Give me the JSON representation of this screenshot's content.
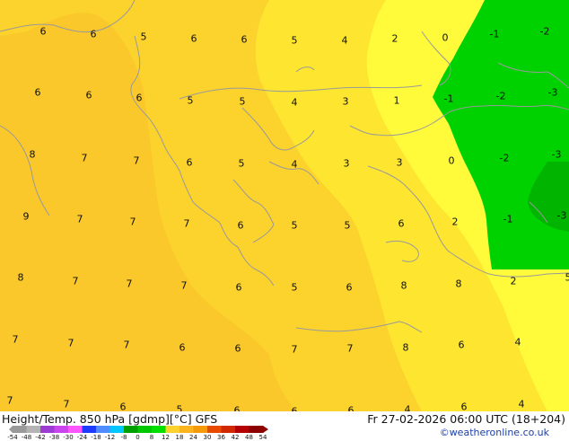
{
  "map": {
    "colors": {
      "band_5_7": "#fcd22c",
      "band_7_9": "#fbc82c",
      "band_3_5": "#fde530",
      "band_0_3": "#fffb3a",
      "band_neg": "#00d200",
      "band_neg_deep": "#00b400",
      "coastline": "#9a9a9a"
    },
    "values": [
      {
        "text": "6"
      },
      {
        "text": "6"
      },
      {
        "text": "5"
      },
      {
        "text": "6"
      },
      {
        "text": "6"
      },
      {
        "text": "5"
      },
      {
        "text": "4"
      },
      {
        "text": "2"
      },
      {
        "text": "0"
      },
      {
        "text": "-1"
      },
      {
        "text": "-2"
      },
      {
        "text": "6"
      },
      {
        "text": "6"
      },
      {
        "text": "6"
      },
      {
        "text": "5"
      },
      {
        "text": "5"
      },
      {
        "text": "4"
      },
      {
        "text": "3"
      },
      {
        "text": "1"
      },
      {
        "text": "-1"
      },
      {
        "text": "-2"
      },
      {
        "text": "-3"
      },
      {
        "text": "8"
      },
      {
        "text": "7"
      },
      {
        "text": "7"
      },
      {
        "text": "6"
      },
      {
        "text": "5"
      },
      {
        "text": "4"
      },
      {
        "text": "3"
      },
      {
        "text": "3"
      },
      {
        "text": "0"
      },
      {
        "text": "-2"
      },
      {
        "text": "-3"
      },
      {
        "text": "9"
      },
      {
        "text": "7"
      },
      {
        "text": "7"
      },
      {
        "text": "7"
      },
      {
        "text": "6"
      },
      {
        "text": "5"
      },
      {
        "text": "5"
      },
      {
        "text": "6"
      },
      {
        "text": "2"
      },
      {
        "text": "-1"
      },
      {
        "text": "-3"
      },
      {
        "text": "8"
      },
      {
        "text": "7"
      },
      {
        "text": "7"
      },
      {
        "text": "7"
      },
      {
        "text": "6"
      },
      {
        "text": "5"
      },
      {
        "text": "6"
      },
      {
        "text": "8"
      },
      {
        "text": "8"
      },
      {
        "text": "2"
      },
      {
        "text": "5"
      },
      {
        "text": "7"
      },
      {
        "text": "7"
      },
      {
        "text": "7"
      },
      {
        "text": "6"
      },
      {
        "text": "6"
      },
      {
        "text": "7"
      },
      {
        "text": "7"
      },
      {
        "text": "8"
      },
      {
        "text": "6"
      },
      {
        "text": "4"
      },
      {
        "text": "7"
      },
      {
        "text": "7"
      },
      {
        "text": "6"
      },
      {
        "text": "5"
      },
      {
        "text": "6"
      },
      {
        "text": "6"
      },
      {
        "text": "6"
      },
      {
        "text": "4"
      },
      {
        "text": "6"
      },
      {
        "text": "4"
      }
    ]
  },
  "footer": {
    "title": "Height/Temp. 850 hPa [gdmp][°C] GFS",
    "datetime": "Fr 27-02-2026 06:00 UTC (18+204)",
    "credit": "©weatheronline.co.uk",
    "scale": {
      "labels": [
        "-54",
        "-48",
        "-42",
        "-38",
        "-30",
        "-24",
        "-18",
        "-12",
        "-8",
        "0",
        "8",
        "12",
        "18",
        "24",
        "30",
        "36",
        "42",
        "48",
        "54"
      ],
      "colors": [
        "#9a9a9a",
        "#b4b4b4",
        "#9c3cd2",
        "#cc44ee",
        "#ff55ff",
        "#1e3cff",
        "#4f8cff",
        "#00c8ff",
        "#00a000",
        "#00c800",
        "#00e000",
        "#fcd22c",
        "#fbb41e",
        "#f59a0a",
        "#e84a00",
        "#d22800",
        "#b40000",
        "#8c0000"
      ]
    }
  }
}
